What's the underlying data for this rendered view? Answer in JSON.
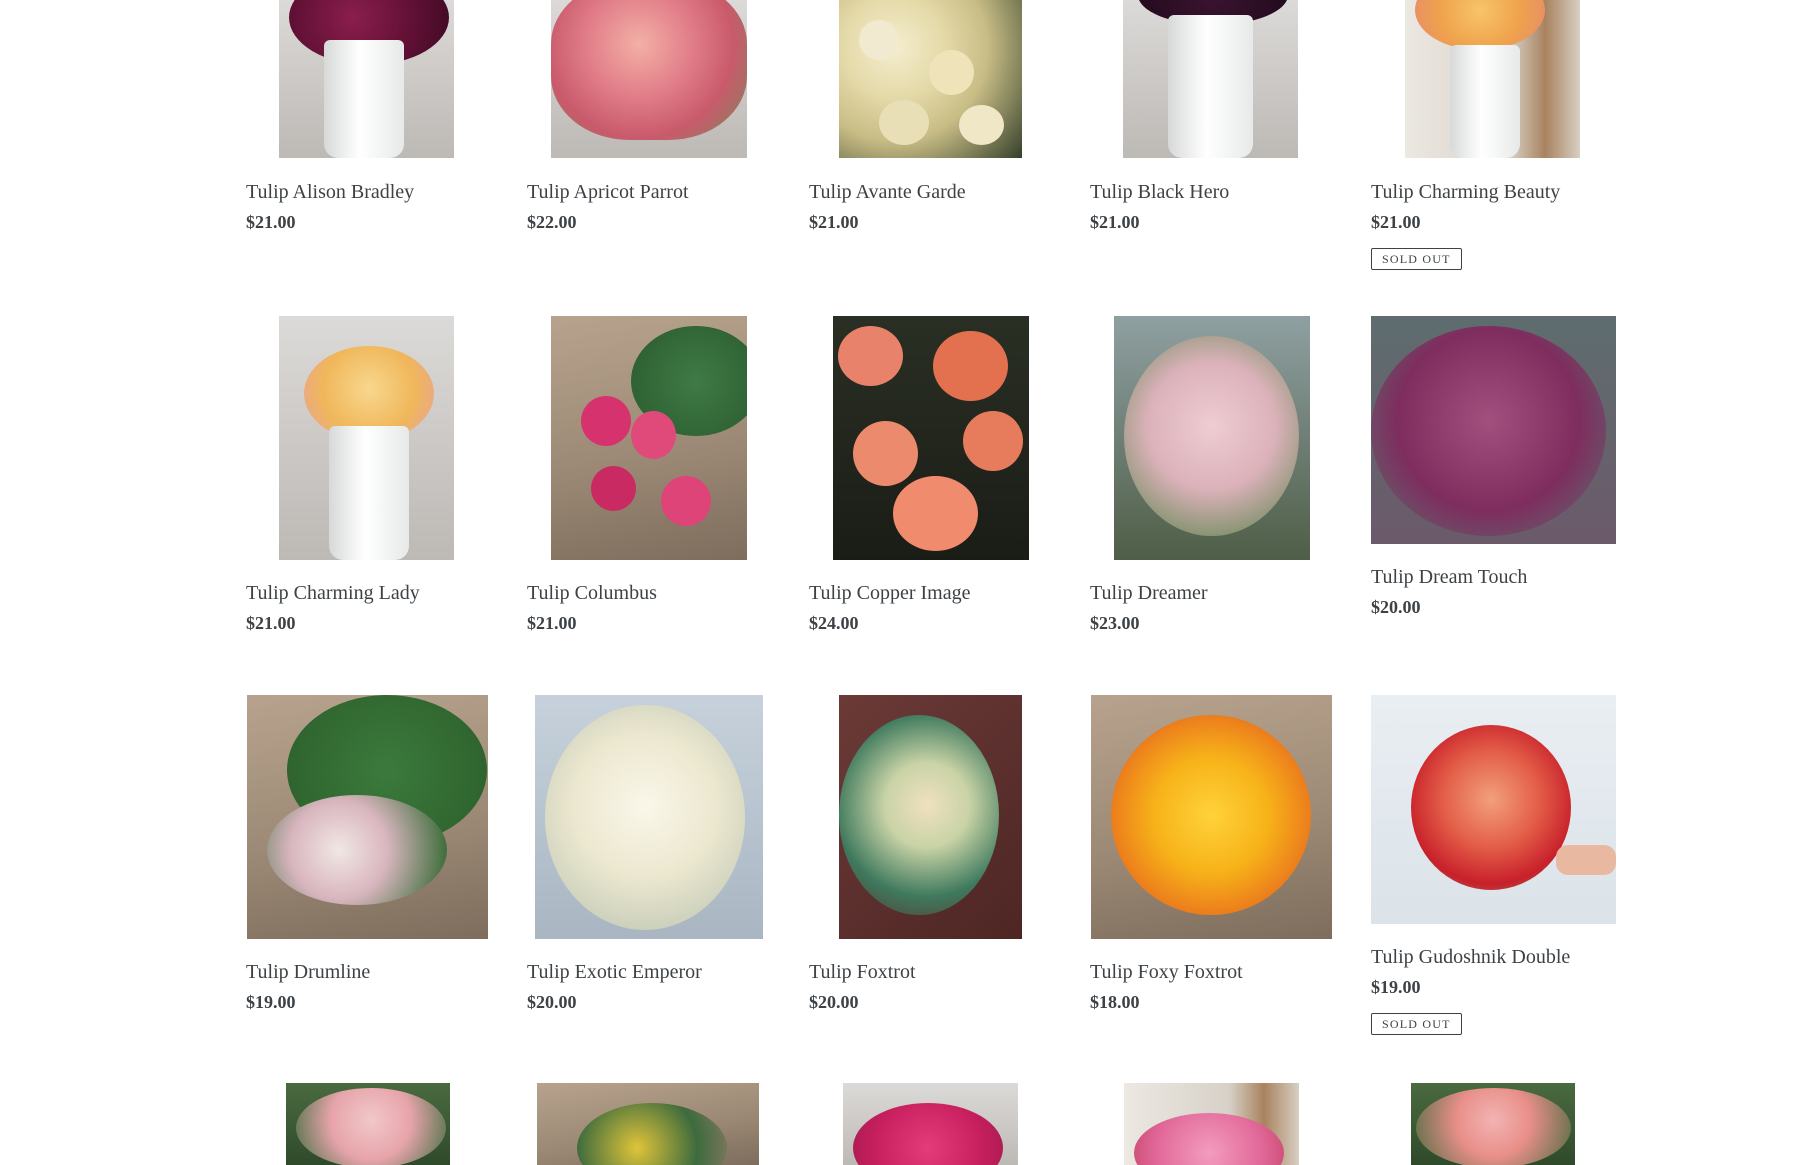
{
  "colors": {
    "text": "#3d4246",
    "background": "#ffffff",
    "badge_border": "#3d4246"
  },
  "products": [
    {
      "title": "Tulip Alison Bradley",
      "price": "$21.00",
      "badge": ""
    },
    {
      "title": "Tulip Apricot Parrot",
      "price": "$22.00",
      "badge": ""
    },
    {
      "title": "Tulip Avante Garde",
      "price": "$21.00",
      "badge": ""
    },
    {
      "title": "Tulip Black Hero",
      "price": "$21.00",
      "badge": ""
    },
    {
      "title": "Tulip Charming Beauty",
      "price": "$21.00",
      "badge": "Sold out"
    },
    {
      "title": "Tulip Charming Lady",
      "price": "$21.00",
      "badge": ""
    },
    {
      "title": "Tulip Columbus",
      "price": "$21.00",
      "badge": ""
    },
    {
      "title": "Tulip Copper Image",
      "price": "$24.00",
      "badge": ""
    },
    {
      "title": "Tulip Dreamer",
      "price": "$23.00",
      "badge": ""
    },
    {
      "title": "Tulip Dream Touch",
      "price": "$20.00",
      "badge": ""
    },
    {
      "title": "Tulip Drumline",
      "price": "$19.00",
      "badge": ""
    },
    {
      "title": "Tulip Exotic Emperor",
      "price": "$20.00",
      "badge": ""
    },
    {
      "title": "Tulip Foxtrot",
      "price": "$20.00",
      "badge": ""
    },
    {
      "title": "Tulip Foxy Foxtrot",
      "price": "$18.00",
      "badge": ""
    },
    {
      "title": "Tulip Gudoshnik Double",
      "price": "$19.00",
      "badge": "Sold out"
    }
  ]
}
